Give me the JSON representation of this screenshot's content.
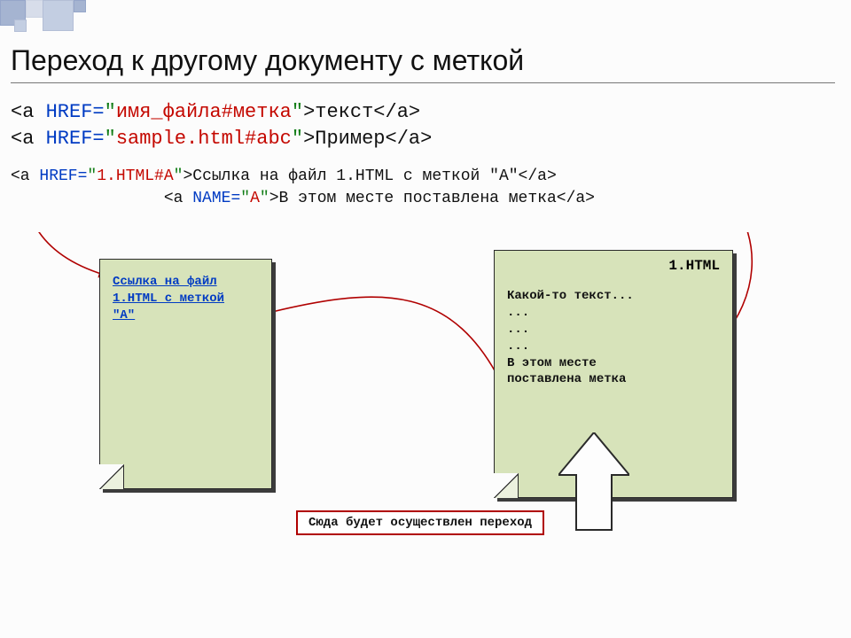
{
  "title": "Переход к другому документу с меткой",
  "syntax": {
    "line1": {
      "open": "<a ",
      "href_kw": "HREF=",
      "q1": "\"",
      "href_value": "имя_файла#метка",
      "q2": "\"",
      "close_open": ">",
      "link_text": "текст",
      "close": "</a>"
    },
    "line2": {
      "open": "<a ",
      "href_kw": "HREF=",
      "q1": "\"",
      "href_value": "sample.html#abc",
      "q2": "\"",
      "close_open": ">",
      "link_text": "Пример",
      "close": "</a>"
    }
  },
  "example": {
    "line1": {
      "open": "<a ",
      "href_kw": "HREF=",
      "q1": "\"",
      "href_value": "1.HTML#A",
      "q2": "\"",
      "close_open": ">",
      "link_text": "Ссылка на файл 1.HTML с меткой \"A\"",
      "close": "</a>"
    },
    "line2": {
      "indent": "                ",
      "open": "<a ",
      "name_kw": "NAME=",
      "q1": "\"",
      "name_value": "A",
      "q2": "\"",
      "close_open": ">",
      "link_text": "В этом месте поставлена метка",
      "close": "</a>"
    }
  },
  "page_left": {
    "link_text_l1": "Ссылка на файл",
    "link_text_l2": "1.HTML с меткой",
    "link_text_l3": "\"A\""
  },
  "page_right": {
    "title": "1.HTML",
    "lines": [
      "Какой-то текст...",
      "...",
      "...",
      "...",
      "В этом месте",
      "поставлена метка"
    ]
  },
  "callout": "Сюда будет осуществлен переход"
}
